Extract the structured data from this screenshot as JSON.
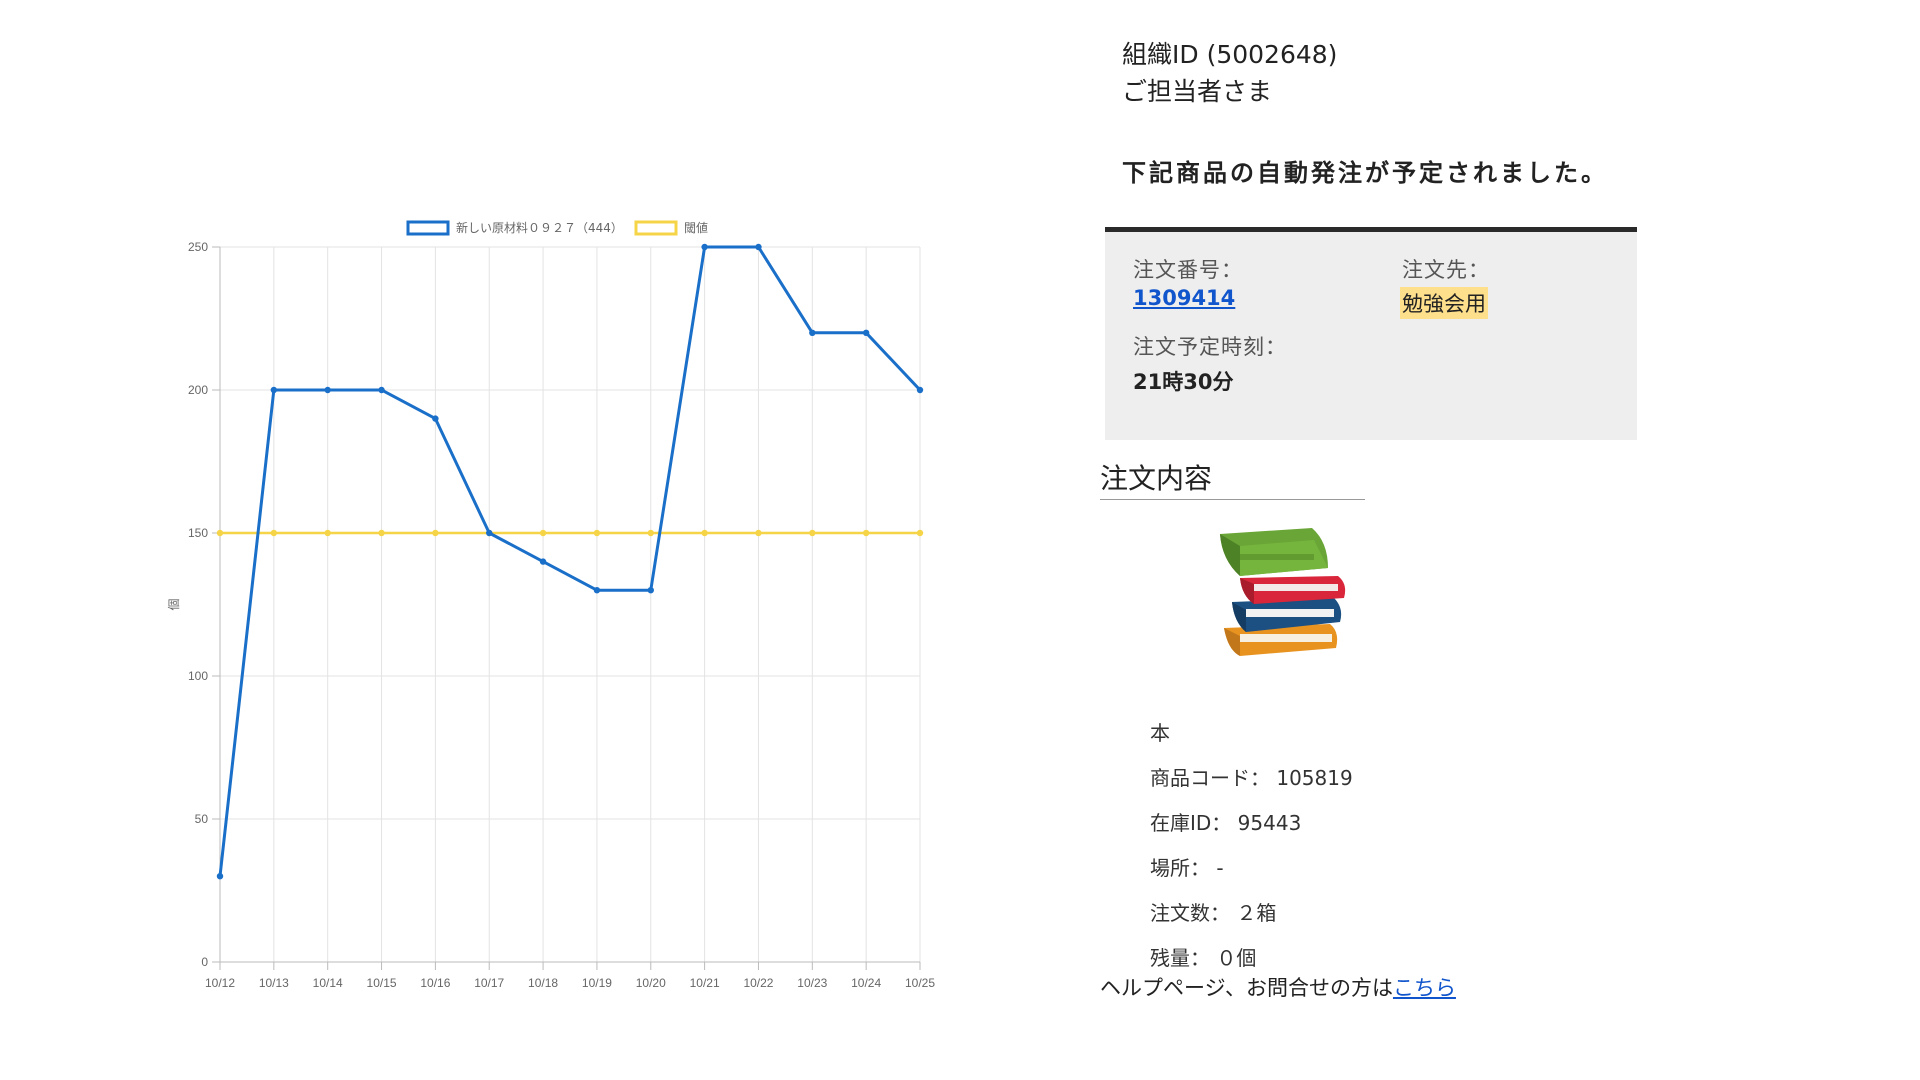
{
  "chart_data": {
    "type": "line",
    "categories": [
      "10/12",
      "10/13",
      "10/14",
      "10/15",
      "10/16",
      "10/17",
      "10/18",
      "10/19",
      "10/20",
      "10/21",
      "10/22",
      "10/23",
      "10/24",
      "10/25"
    ],
    "series": [
      {
        "name": "新しい原材料０９２７（444）",
        "color": "#1a6fc9",
        "values": [
          30,
          200,
          200,
          200,
          190,
          150,
          140,
          130,
          130,
          250,
          250,
          220,
          220,
          200
        ]
      },
      {
        "name": "閾値",
        "color": "#f6d447",
        "values": [
          150,
          150,
          150,
          150,
          150,
          150,
          150,
          150,
          150,
          150,
          150,
          150,
          150,
          150
        ]
      }
    ],
    "ylabel": "個",
    "ylim": [
      0,
      250
    ],
    "yticks": [
      0,
      50,
      100,
      150,
      200,
      250
    ],
    "grid": true,
    "legend": "top-center"
  },
  "mail": {
    "org_line": "組織ID (5002648)",
    "greeting": "ご担当者さま",
    "intro": "下記商品の自動発注が予定されました。",
    "order": {
      "number_label": "注文番号：",
      "number_value": "1309414",
      "destination_label": "注文先：",
      "destination_value": "勉強会用",
      "scheduled_label": "注文予定時刻：",
      "scheduled_value": "21時30分"
    },
    "section_title": "注文内容",
    "item": {
      "icon": "books-icon",
      "name": "本",
      "code_label": "商品コード：",
      "code_value": "105819",
      "stock_label": "在庫ID：",
      "stock_value": "95443",
      "place_label": "場所：",
      "place_value": "-",
      "qty_label": "注文数：",
      "qty_value": "２箱",
      "remain_label": "残量：",
      "remain_value": "０個"
    },
    "help_text": "ヘルプページ、お問合せの方は",
    "help_link": "こちら"
  }
}
